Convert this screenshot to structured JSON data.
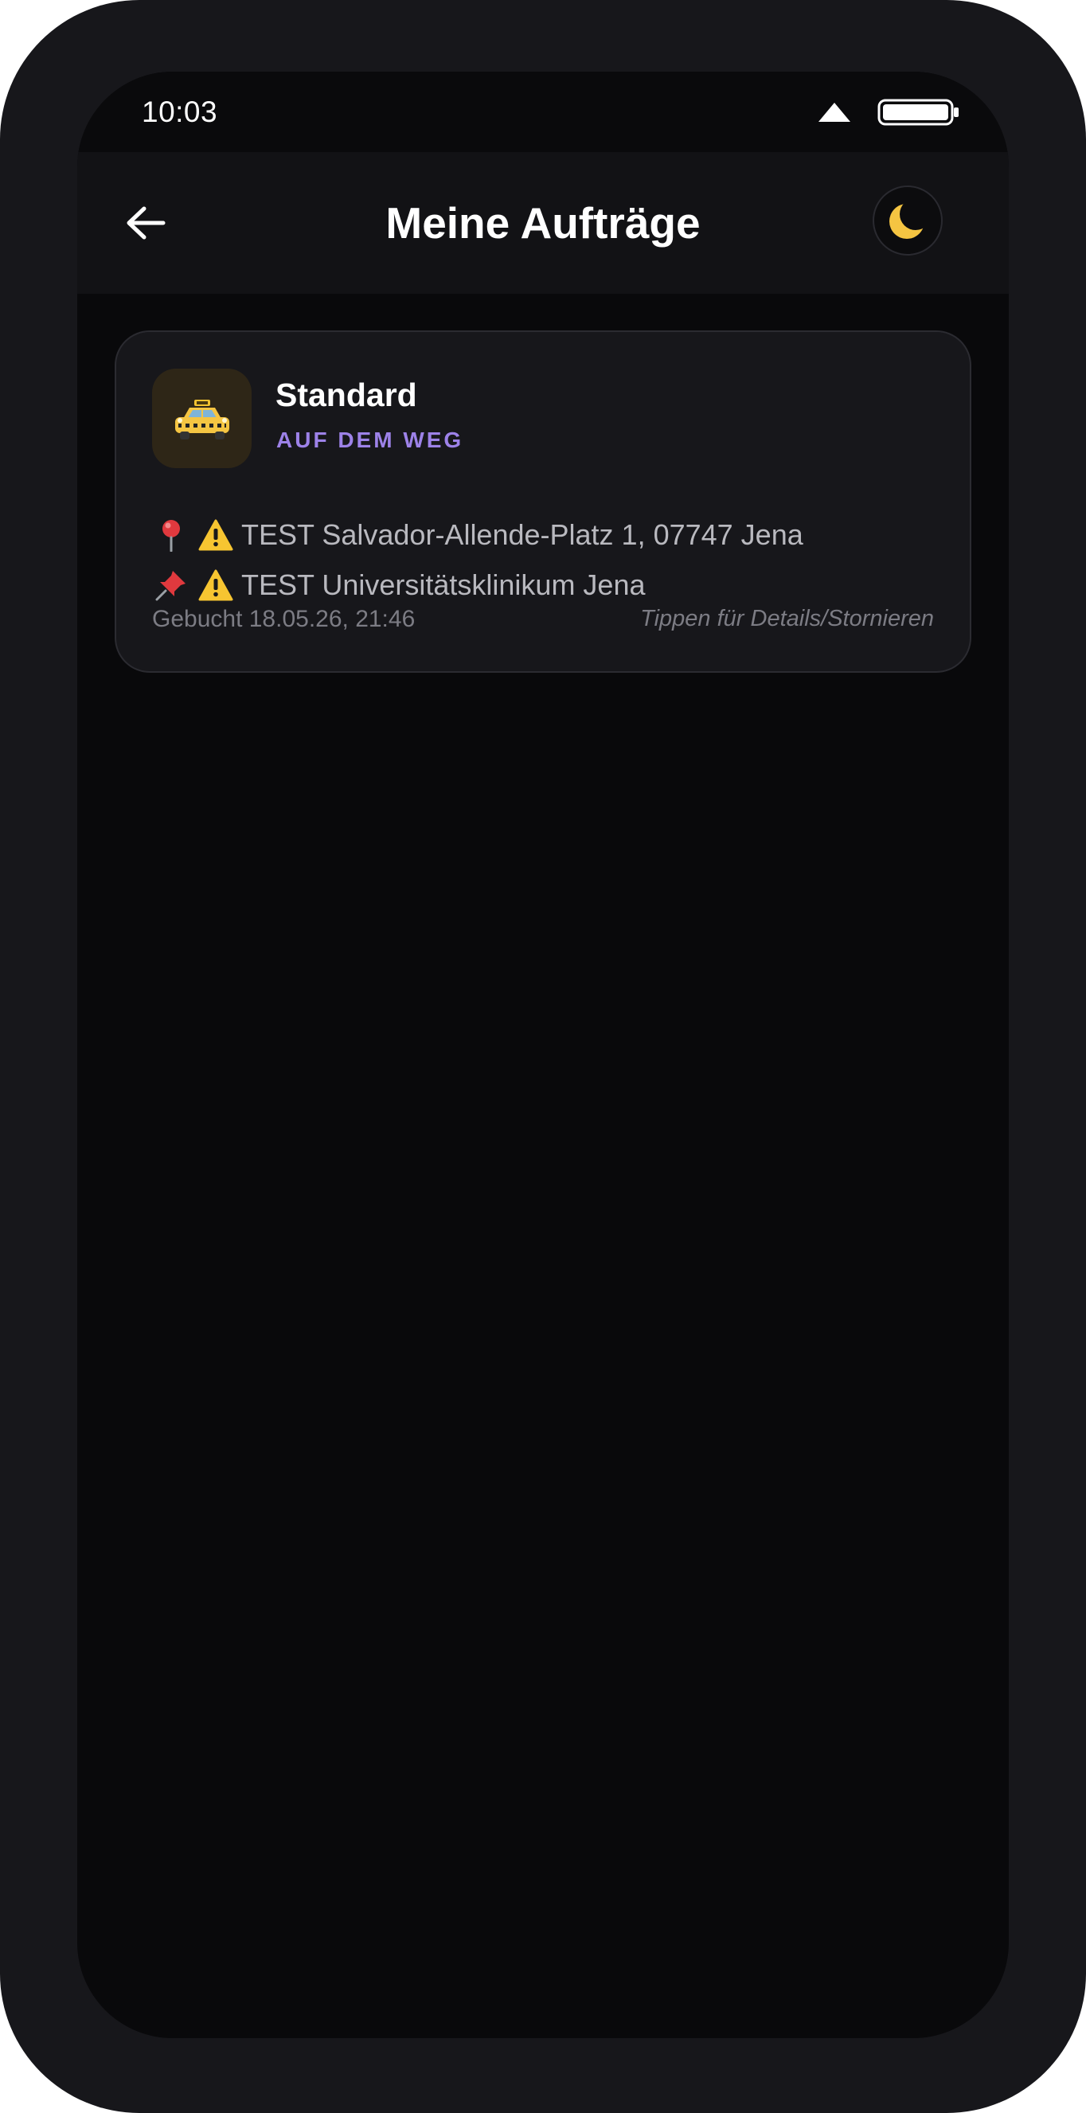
{
  "status_bar": {
    "time": "10:03"
  },
  "header": {
    "title": "Meine Aufträge",
    "back_icon": "arrow-left-icon",
    "theme_icon": "moon-icon"
  },
  "orders": [
    {
      "service_icon": "taxi-icon",
      "service_name": "Standard",
      "status": "AUF DEM WEG",
      "pickup_icon": "map-pin-icon",
      "pickup_warning_icon": "warning-icon",
      "pickup": "TEST Salvador-Allende-Platz 1, 07747 Jena",
      "destination_icon": "pushpin-icon",
      "destination_warning_icon": "warning-icon",
      "destination": "TEST Universitätsklinikum Jena",
      "booked": "Gebucht 18.05.26, 21:46",
      "hint": "Tippen für Details/Stornieren"
    }
  ],
  "colors": {
    "status_accent": "#9d82e8",
    "background": "#09090b",
    "card": "#17171b",
    "moon": "#f5c542"
  }
}
